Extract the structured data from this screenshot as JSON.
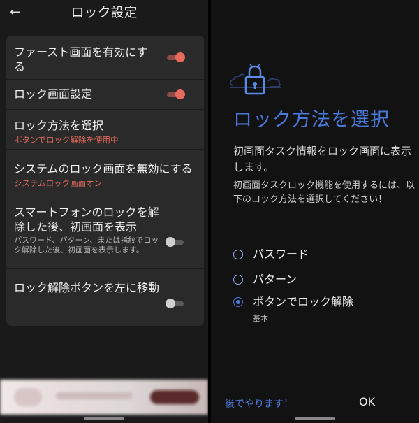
{
  "left": {
    "header": {
      "back_icon": "←",
      "title": "ロック設定"
    },
    "settings": [
      {
        "title": "ファースト画面を有効にする",
        "toggle": "on"
      },
      {
        "title": "ロック画面設定",
        "toggle": "on"
      },
      {
        "title": "ロック方法を選択",
        "subtitle": "ボタンでロック解除を使用中"
      },
      {
        "title": "システムのロック画面を無効にする",
        "subtitle": "システムロック画面オン"
      },
      {
        "title": "スマートフォンのロックを解除した後、初画面を表示",
        "description": "パスワード、パターン、または指紋でロック解除した後、初画面を表示します。",
        "toggle": "off"
      },
      {
        "title": "ロック解除ボタンを左に移動",
        "toggle": "off"
      }
    ]
  },
  "right": {
    "title": "ロック方法を選択",
    "description": "初画面タスク情報をロック画面に表示します。",
    "instruction": "初画面タスクロック機能を使用するには、以下のロック方法を選択してください！",
    "options": [
      {
        "label": "パスワード",
        "selected": false
      },
      {
        "label": "パターン",
        "selected": false
      },
      {
        "label": "ボタンでロック解除",
        "sublabel": "基本",
        "selected": true
      }
    ],
    "footer": {
      "later": "後でやります！",
      "ok": "OK"
    }
  },
  "colors": {
    "accent_red": "#e86a5c",
    "accent_blue": "#4a78d8"
  },
  "icons": [
    "back-arrow-icon",
    "padlock-icon"
  ]
}
